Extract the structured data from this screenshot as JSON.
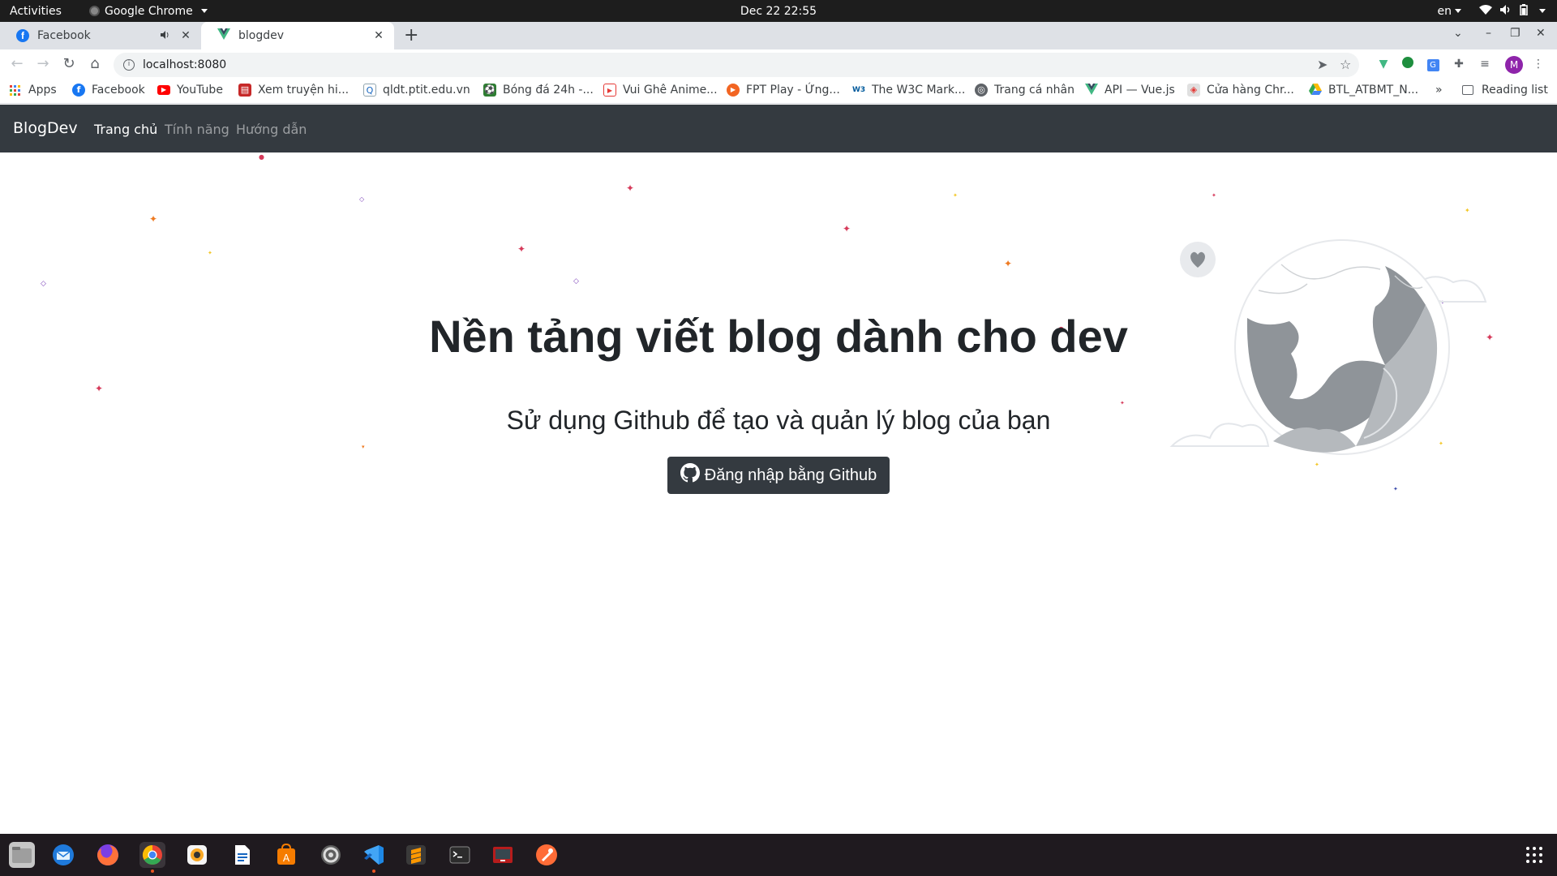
{
  "topbar": {
    "activities": "Activities",
    "app_name": "Google Chrome",
    "clock": "Dec 22  22:55",
    "language": "en"
  },
  "tabs": [
    {
      "title": "Facebook",
      "icon": "facebook-icon",
      "muted": true
    },
    {
      "title": "blogdev",
      "icon": "vue-icon",
      "active": true
    }
  ],
  "omnibox": {
    "url": "localhost:8080"
  },
  "bookmarks": [
    {
      "label": "Apps",
      "icon": "apps-grid-icon"
    },
    {
      "label": "Facebook",
      "icon": "facebook-icon"
    },
    {
      "label": "YouTube",
      "icon": "youtube-icon"
    },
    {
      "label": "Xem truyện hi...",
      "icon": "comic-icon"
    },
    {
      "label": "qldt.ptit.edu.vn",
      "icon": "ptit-icon"
    },
    {
      "label": "Bóng đá 24h -...",
      "icon": "football-icon"
    },
    {
      "label": "Vui Ghê Anime...",
      "icon": "anime-icon"
    },
    {
      "label": "FPT Play - Ứng...",
      "icon": "fptplay-icon"
    },
    {
      "label": "The W3C Mark...",
      "icon": "w3c-icon"
    },
    {
      "label": "Trang cá nhân",
      "icon": "globe-icon"
    },
    {
      "label": "API — Vue.js",
      "icon": "vue-icon"
    },
    {
      "label": "Cửa hàng Chr...",
      "icon": "chrome-store-icon"
    },
    {
      "label": "BTL_ATBMT_N...",
      "icon": "google-drive-icon"
    }
  ],
  "reading_list": "Reading list",
  "profile_initial": "M",
  "navbar": {
    "brand": "BlogDev",
    "links": [
      "Trang chủ",
      "Tính năng",
      "Hướng dẫn"
    ]
  },
  "hero": {
    "title": "Nền tảng viết blog dành cho dev",
    "subtitle": "Sử dụng Github để tạo và quản lý blog của bạn",
    "button": "Đăng nhập bằng Github"
  },
  "colors": {
    "navbar_bg": "#343a40",
    "button_bg": "#343a40",
    "text_dark": "#212529",
    "sparkle_red": "#d63a5a",
    "sparkle_orange": "#ee7a22",
    "sparkle_yellow": "#f3c623",
    "sparkle_purple": "#7a3fb8"
  },
  "dock": [
    {
      "icon": "files-icon"
    },
    {
      "icon": "thunderbird-icon"
    },
    {
      "icon": "firefox-icon"
    },
    {
      "icon": "chrome-icon"
    },
    {
      "icon": "rhythmbox-icon"
    },
    {
      "icon": "writer-icon"
    },
    {
      "icon": "software-center-icon"
    },
    {
      "icon": "settings-icon"
    },
    {
      "icon": "vscode-icon"
    },
    {
      "icon": "sublime-icon"
    },
    {
      "icon": "terminal-icon"
    },
    {
      "icon": "screen-recorder-icon"
    },
    {
      "icon": "postman-icon"
    }
  ]
}
